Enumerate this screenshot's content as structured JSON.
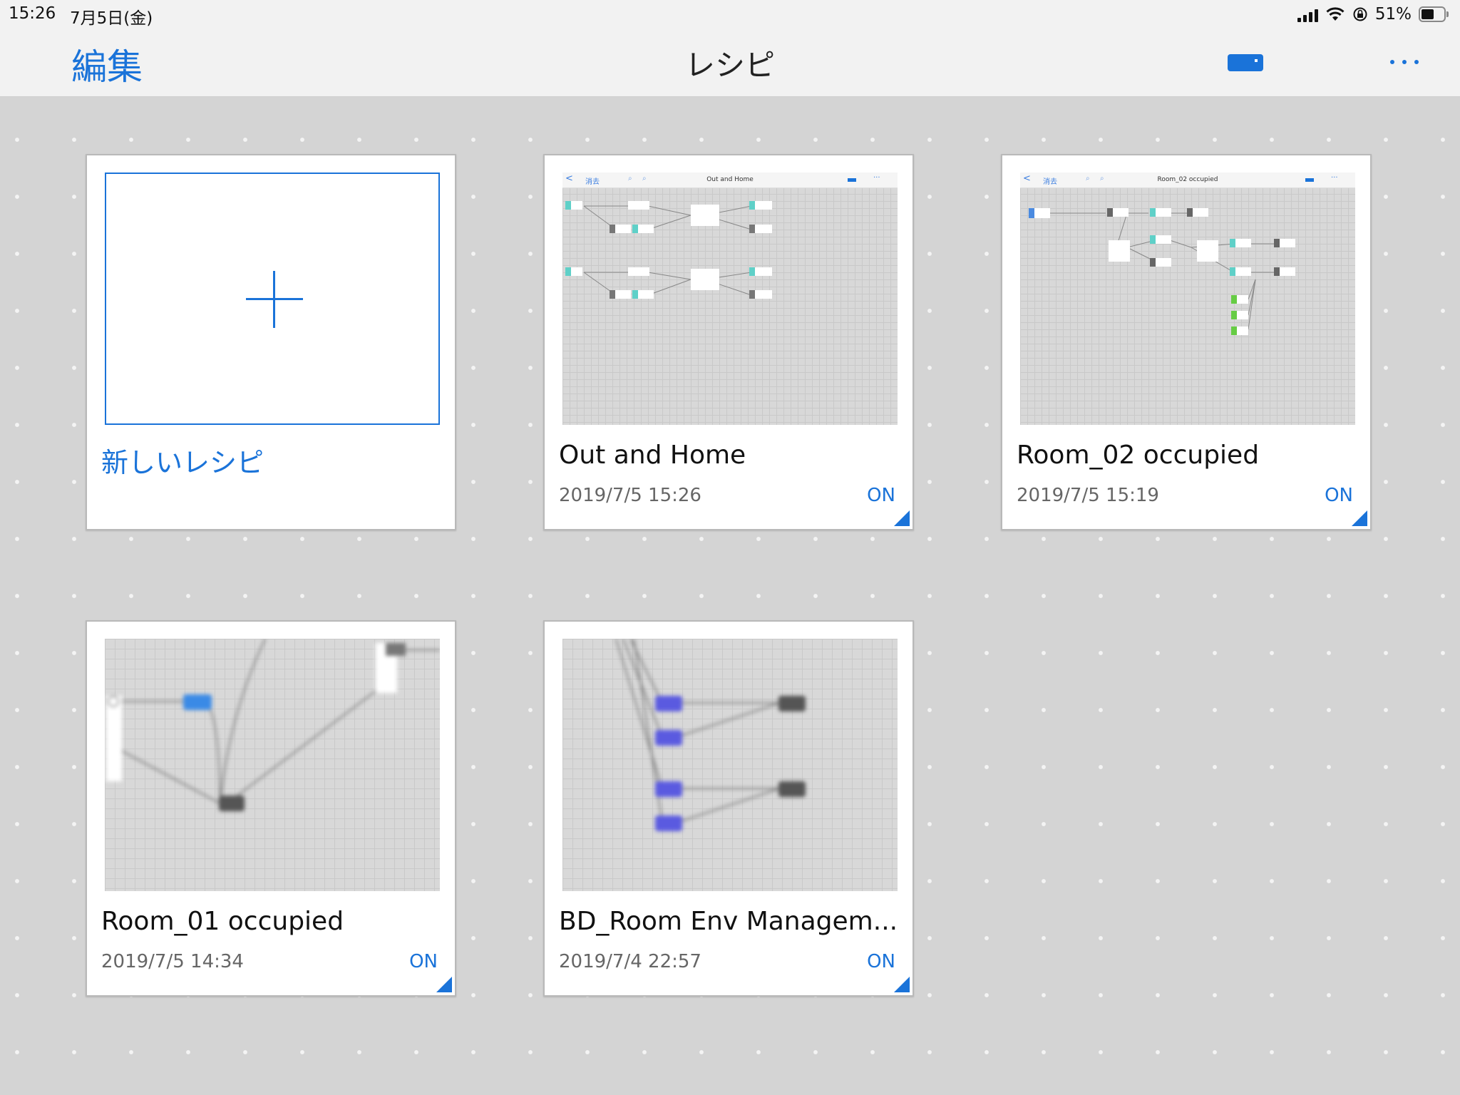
{
  "status_bar": {
    "time": "15:26",
    "date": "7月5日(金)",
    "battery": "51%"
  },
  "nav": {
    "edit": "編集",
    "title": "レシピ"
  },
  "new_recipe": {
    "label": "新しいレシピ"
  },
  "mini_nav": {
    "back": "<",
    "edit": "消去",
    "more": "···"
  },
  "recipes": [
    {
      "title": "Out and Home",
      "date": "2019/7/5 15:26",
      "status": "ON",
      "thumb_title": "Out and Home"
    },
    {
      "title": "Room_02 occupied",
      "date": "2019/7/5 15:19",
      "status": "ON",
      "thumb_title": "Room_02 occupied"
    },
    {
      "title": "Room_01 occupied",
      "date": "2019/7/5 14:34",
      "status": "ON"
    },
    {
      "title": "BD_Room Env Managem...",
      "date": "2019/7/4 22:57",
      "status": "ON"
    }
  ],
  "colors": {
    "accent": "#1a73d9",
    "background": "#d4d4d4",
    "card": "#ffffff"
  }
}
